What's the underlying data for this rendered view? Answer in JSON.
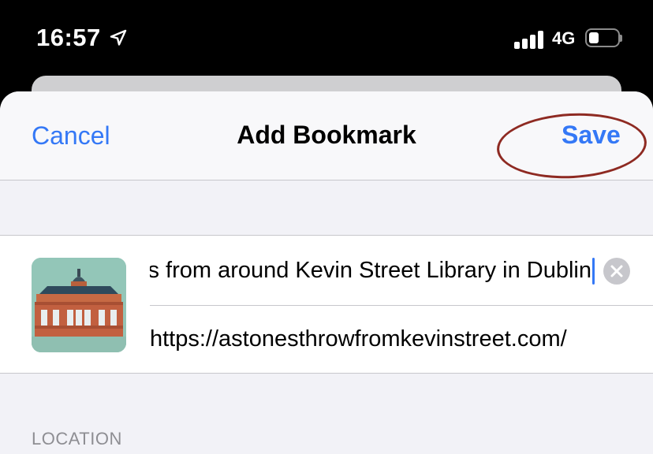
{
  "status_bar": {
    "time": "16:57",
    "network": "4G",
    "battery_level_fraction": 0.25,
    "signal_bars": 4
  },
  "nav": {
    "cancel_label": "Cancel",
    "title": "Add Bookmark",
    "save_label": "Save"
  },
  "bookmark": {
    "title_value": "es from around Kevin Street Library in Dublin",
    "url_value": "https://astonesthrowfromkevinstreet.com/"
  },
  "section": {
    "location_header": "LOCATION"
  },
  "colors": {
    "accent": "#3478f6",
    "annotation": "#8e2a22"
  }
}
